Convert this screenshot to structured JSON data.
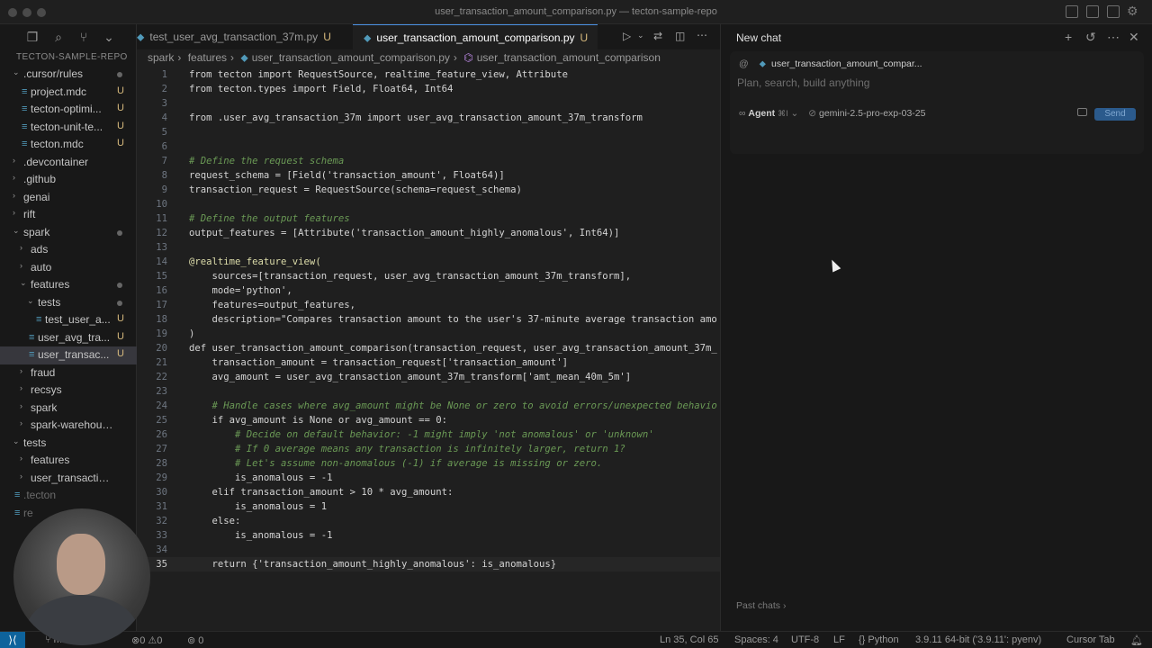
{
  "window": {
    "title": "user_transaction_amount_comparison.py — tecton-sample-repo"
  },
  "tabs": [
    {
      "label": "test_user_avg_transaction_37m.py",
      "status": "U"
    },
    {
      "label": "user_transaction_amount_comparison.py",
      "status": "U"
    }
  ],
  "breadcrumb": [
    "spark",
    "features",
    "user_transaction_amount_comparison.py",
    "user_transaction_amount_comparison"
  ],
  "explorer": {
    "repo": "TECTON-SAMPLE-REPO",
    "items": [
      {
        "label": ".cursor/rules",
        "marker": "dot"
      },
      {
        "label": "project.mdc",
        "marker": "U"
      },
      {
        "label": "tecton-optimi...",
        "marker": "U"
      },
      {
        "label": "tecton-unit-te...",
        "marker": "U"
      },
      {
        "label": "tecton.mdc",
        "marker": "U"
      },
      {
        "label": ".devcontainer",
        "marker": ""
      },
      {
        "label": ".github",
        "marker": ""
      },
      {
        "label": "genai",
        "marker": ""
      },
      {
        "label": "rift",
        "marker": ""
      },
      {
        "label": "spark",
        "marker": "dot"
      },
      {
        "label": "ads",
        "marker": ""
      },
      {
        "label": "auto",
        "marker": ""
      },
      {
        "label": "features",
        "marker": "dot"
      },
      {
        "label": "tests",
        "marker": "dot"
      },
      {
        "label": "test_user_a...",
        "marker": "U"
      },
      {
        "label": "user_avg_tra...",
        "marker": "U"
      },
      {
        "label": "user_transac...",
        "marker": "U"
      },
      {
        "label": "fraud",
        "marker": ""
      },
      {
        "label": "recsys",
        "marker": ""
      },
      {
        "label": "spark",
        "marker": ""
      },
      {
        "label": "spark-warehouse",
        "marker": ""
      },
      {
        "label": "tests",
        "marker": ""
      },
      {
        "label": "features",
        "marker": ""
      },
      {
        "label": "user_transaction_...",
        "marker": ""
      },
      {
        "label": ".tecton",
        "marker": ""
      },
      {
        "label": "re",
        "marker": ""
      }
    ]
  },
  "code": {
    "current_line": 35,
    "lines": [
      "from tecton import RequestSource, realtime_feature_view, Attribute",
      "from tecton.types import Field, Float64, Int64",
      "",
      "from .user_avg_transaction_37m import user_avg_transaction_amount_37m_transform",
      "",
      "",
      "# Define the request schema",
      "request_schema = [Field('transaction_amount', Float64)]",
      "transaction_request = RequestSource(schema=request_schema)",
      "",
      "# Define the output features",
      "output_features = [Attribute('transaction_amount_highly_anomalous', Int64)]",
      "",
      "@realtime_feature_view(",
      "    sources=[transaction_request, user_avg_transaction_amount_37m_transform],",
      "    mode='python',",
      "    features=output_features,",
      "    description=\"Compares transaction amount to the user's 37-minute average transaction amo",
      ")",
      "def user_transaction_amount_comparison(transaction_request, user_avg_transaction_amount_37m_",
      "    transaction_amount = transaction_request['transaction_amount']",
      "    avg_amount = user_avg_transaction_amount_37m_transform['amt_mean_40m_5m']",
      "",
      "    # Handle cases where avg_amount might be None or zero to avoid errors/unexpected behavio",
      "    if avg_amount is None or avg_amount == 0:",
      "        # Decide on default behavior: -1 might imply 'not anomalous' or 'unknown'",
      "        # If 0 average means any transaction is infinitely larger, return 1?",
      "        # Let's assume non-anomalous (-1) if average is missing or zero.",
      "        is_anomalous = -1",
      "    elif transaction_amount > 10 * avg_amount:",
      "        is_anomalous = 1",
      "    else:",
      "        is_anomalous = -1",
      "",
      "    return {'transaction_amount_highly_anomalous': is_anomalous}"
    ]
  },
  "chat": {
    "title": "New chat",
    "context_file": "user_transaction_amount_compar...",
    "placeholder": "Plan, search, build anything",
    "mode": "Agent",
    "mode_shortcut": "⌘I",
    "model": "gemini-2.5-pro-exp-03-25",
    "send_label": "Send",
    "past_chats": "Past chats"
  },
  "status": {
    "branch": "main",
    "errors": "0",
    "warnings": "0",
    "ports": "0",
    "position": "Ln 35, Col 65",
    "spaces": "Spaces: 4",
    "encoding": "UTF-8",
    "eol": "LF",
    "language": "Python",
    "interpreter": "3.9.11 64-bit ('3.9.11': pyenv)",
    "cursor_tab": "Cursor Tab"
  }
}
